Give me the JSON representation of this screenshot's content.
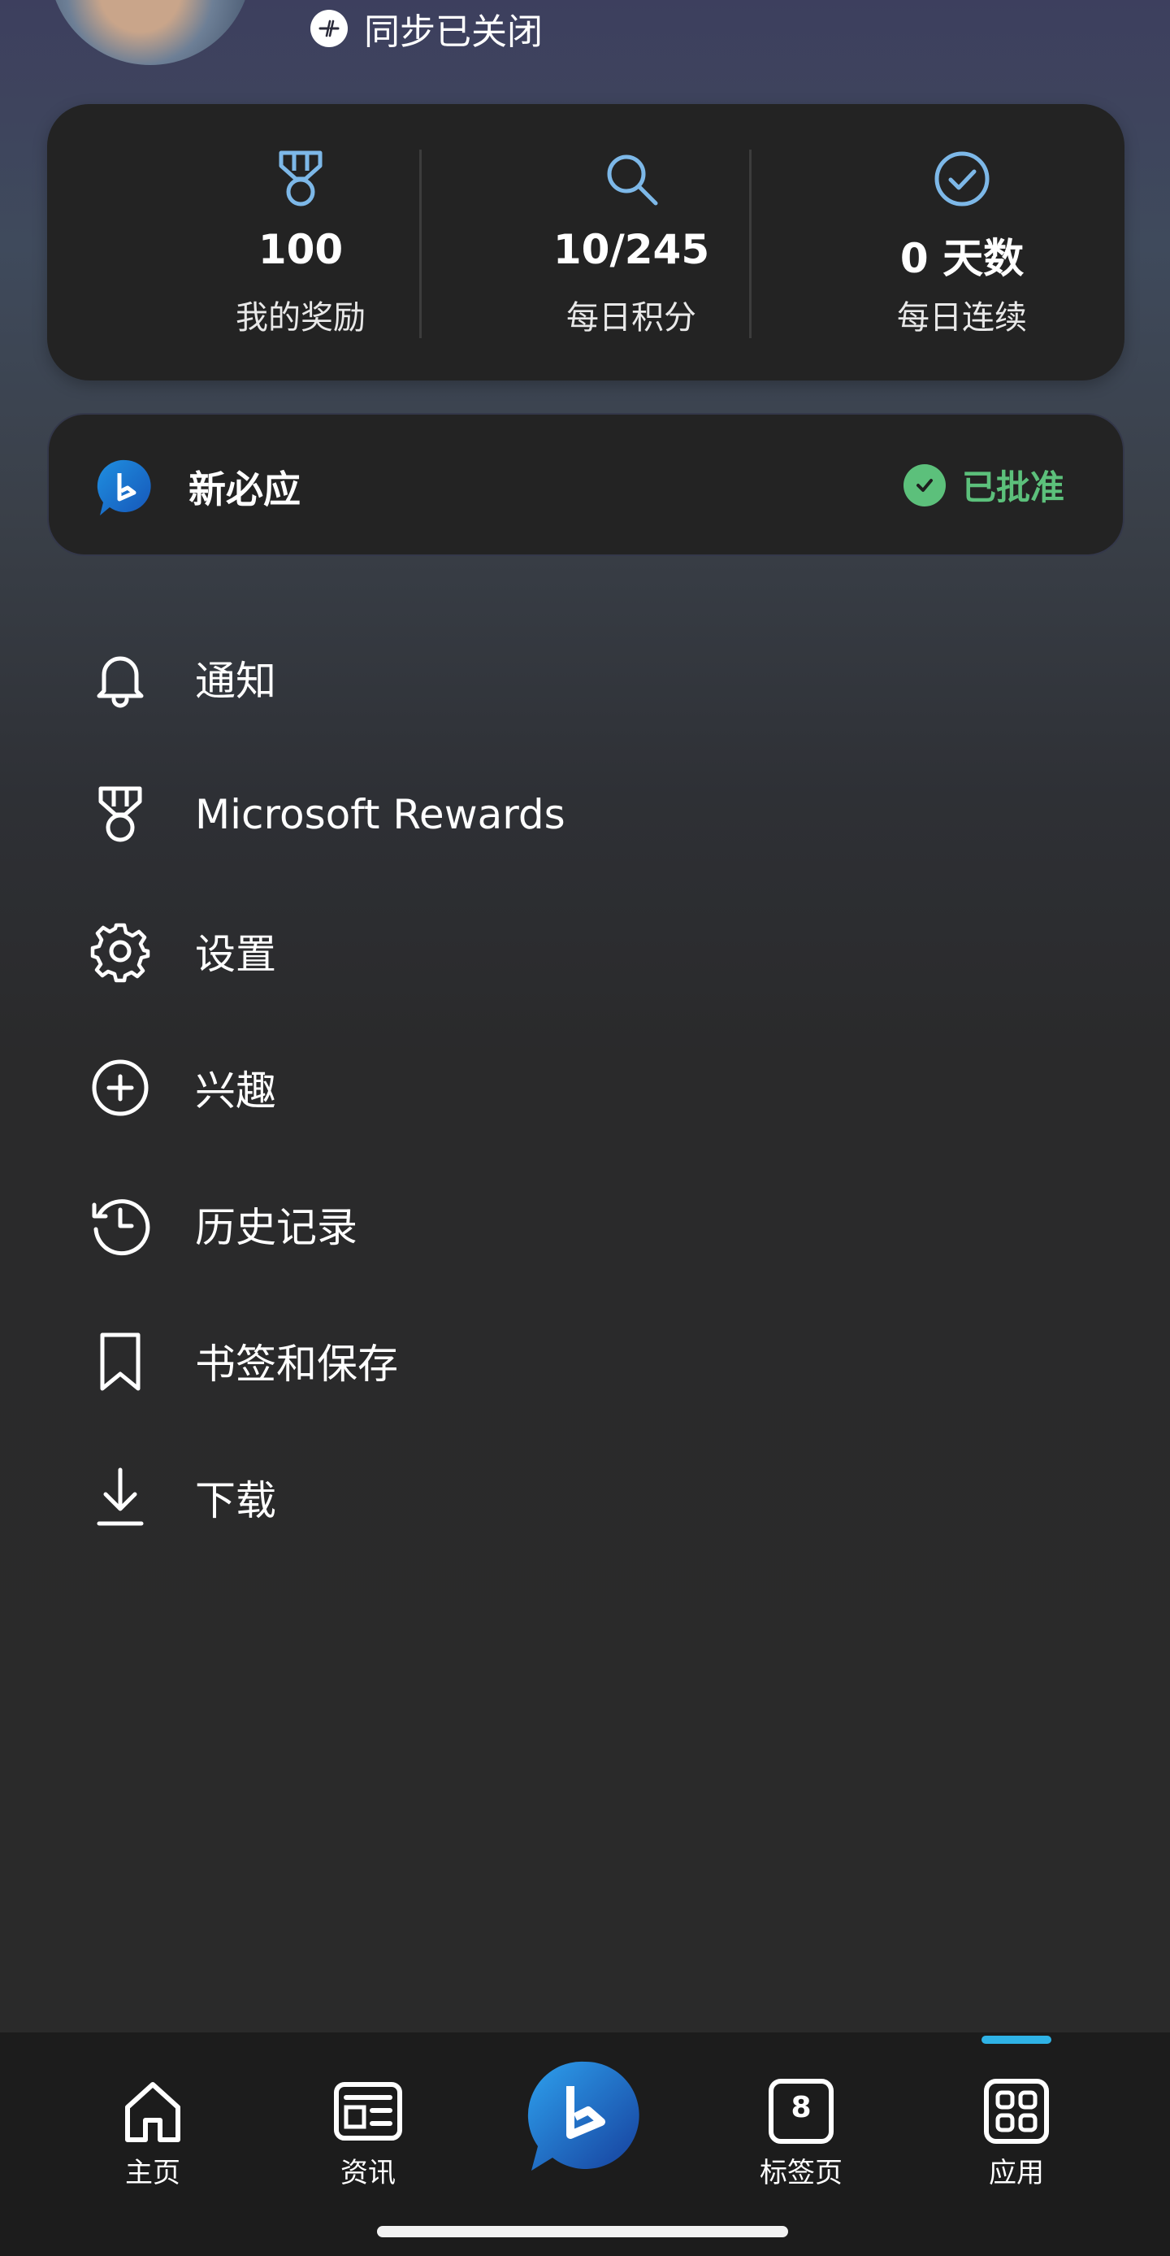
{
  "header": {
    "sync_status": "同步已关闭"
  },
  "stats": [
    {
      "icon": "medal-icon",
      "value": "100",
      "label": "我的奖励"
    },
    {
      "icon": "search-icon",
      "value": "10/245",
      "label": "每日积分"
    },
    {
      "icon": "check-circle-icon",
      "value": "0 天数",
      "label": "每日连续"
    }
  ],
  "bing_card": {
    "name": "新必应",
    "status": "已批准",
    "status_color": "#5cc07b"
  },
  "menu": {
    "items": [
      {
        "label": "通知",
        "icon": "bell-icon"
      },
      {
        "label": "Microsoft Rewards",
        "icon": "medal-icon"
      },
      {
        "label": "设置",
        "icon": "gear-icon"
      },
      {
        "label": "兴趣",
        "icon": "plus-circle-icon"
      },
      {
        "label": "历史记录",
        "icon": "history-icon"
      },
      {
        "label": "书签和保存",
        "icon": "bookmark-icon"
      },
      {
        "label": "下载",
        "icon": "download-icon"
      }
    ]
  },
  "bottom_nav": {
    "items": [
      {
        "label": "主页",
        "icon": "home-icon"
      },
      {
        "label": "资讯",
        "icon": "news-icon"
      },
      {
        "label": "",
        "icon": "bing-chat-icon"
      },
      {
        "label": "标签页",
        "icon": "tabs-icon",
        "count": "8"
      },
      {
        "label": "应用",
        "icon": "apps-icon"
      }
    ],
    "accent_color": "#2fb3e6"
  }
}
